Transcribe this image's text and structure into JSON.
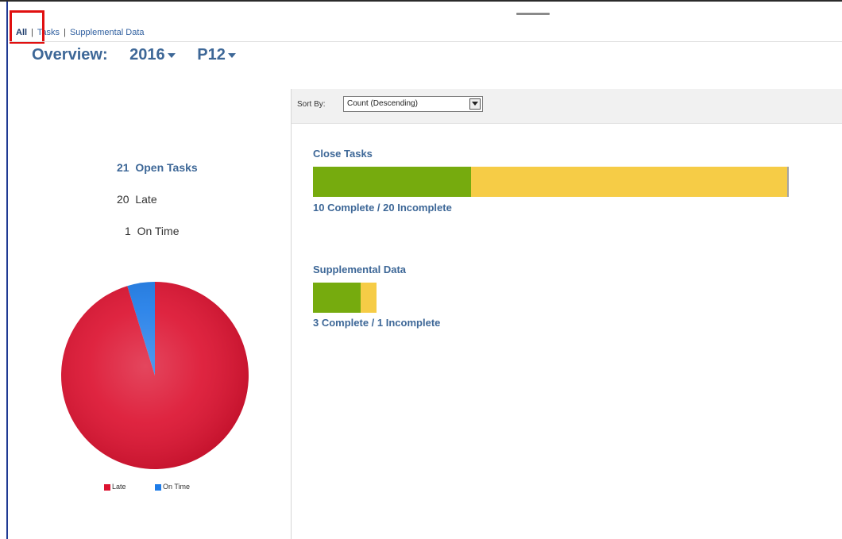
{
  "nav": {
    "tabs": [
      {
        "label": "All"
      },
      {
        "label": "Tasks"
      },
      {
        "label": "Supplemental Data"
      }
    ],
    "separator": "|"
  },
  "header": {
    "title": "Overview:",
    "year": "2016",
    "period": "P12"
  },
  "summary": {
    "open_tasks_count": "21",
    "open_tasks_label": "Open Tasks",
    "late_count": "20",
    "late_label": "Late",
    "on_time_count": "1",
    "on_time_label": "On Time"
  },
  "pie": {
    "slices": [
      {
        "name": "Late",
        "value": 20,
        "color": "#dc1230"
      },
      {
        "name": "On Time",
        "value": 1,
        "color": "#1e7ce8"
      }
    ]
  },
  "legend": {
    "items": [
      {
        "label": "Late",
        "color": "#dc1230"
      },
      {
        "label": "On Time",
        "color": "#1e7ce8"
      }
    ]
  },
  "sort": {
    "label": "Sort By:",
    "selected": "Count (Descending)"
  },
  "groups": [
    {
      "title": "Close Tasks",
      "complete": 10,
      "incomplete": 20,
      "summary": "10 Complete / 20 Incomplete"
    },
    {
      "title": "Supplemental Data",
      "complete": 3,
      "incomplete": 1,
      "summary": "3 Complete / 1 Incomplete"
    }
  ],
  "colors": {
    "complete": "#76ab0e",
    "incomplete": "#f6cc46",
    "link": "#3d6797",
    "highlight": "#e01010"
  }
}
